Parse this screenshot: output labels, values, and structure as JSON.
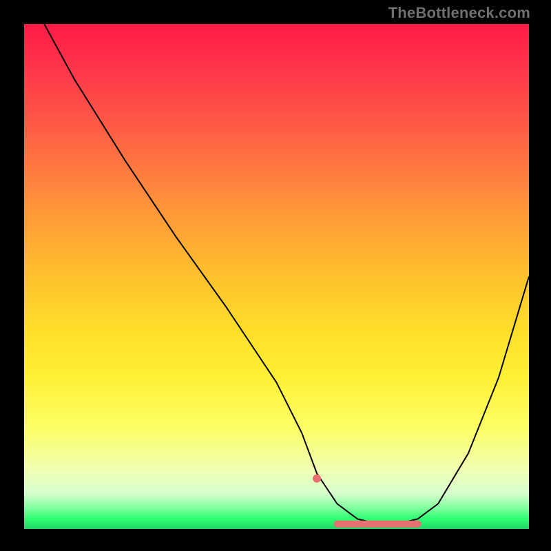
{
  "watermark": "TheBottleneck.com",
  "chart_data": {
    "type": "line",
    "title": "",
    "xlabel": "",
    "ylabel": "",
    "xlim": [
      0,
      100
    ],
    "ylim": [
      0,
      100
    ],
    "grid": false,
    "legend": false,
    "background": "gradient red→green (top→bottom)",
    "series": [
      {
        "name": "curve",
        "x": [
          4,
          10,
          20,
          30,
          40,
          50,
          55,
          58,
          62,
          66,
          70,
          74,
          78,
          82,
          88,
          94,
          100
        ],
        "y": [
          100,
          89,
          73,
          58,
          44,
          29,
          19,
          11,
          5,
          2,
          1,
          1,
          2,
          5,
          15,
          30,
          50
        ]
      }
    ],
    "annotations": {
      "marker_dot": {
        "x": 58,
        "y": 10
      },
      "marker_segment": {
        "x_start": 62,
        "x_end": 78,
        "y": 1
      }
    },
    "colors": {
      "curve": "#000000",
      "marker": "#e76f6f",
      "gradient_top": "#ff1a47",
      "gradient_bottom": "#1fd667"
    }
  }
}
